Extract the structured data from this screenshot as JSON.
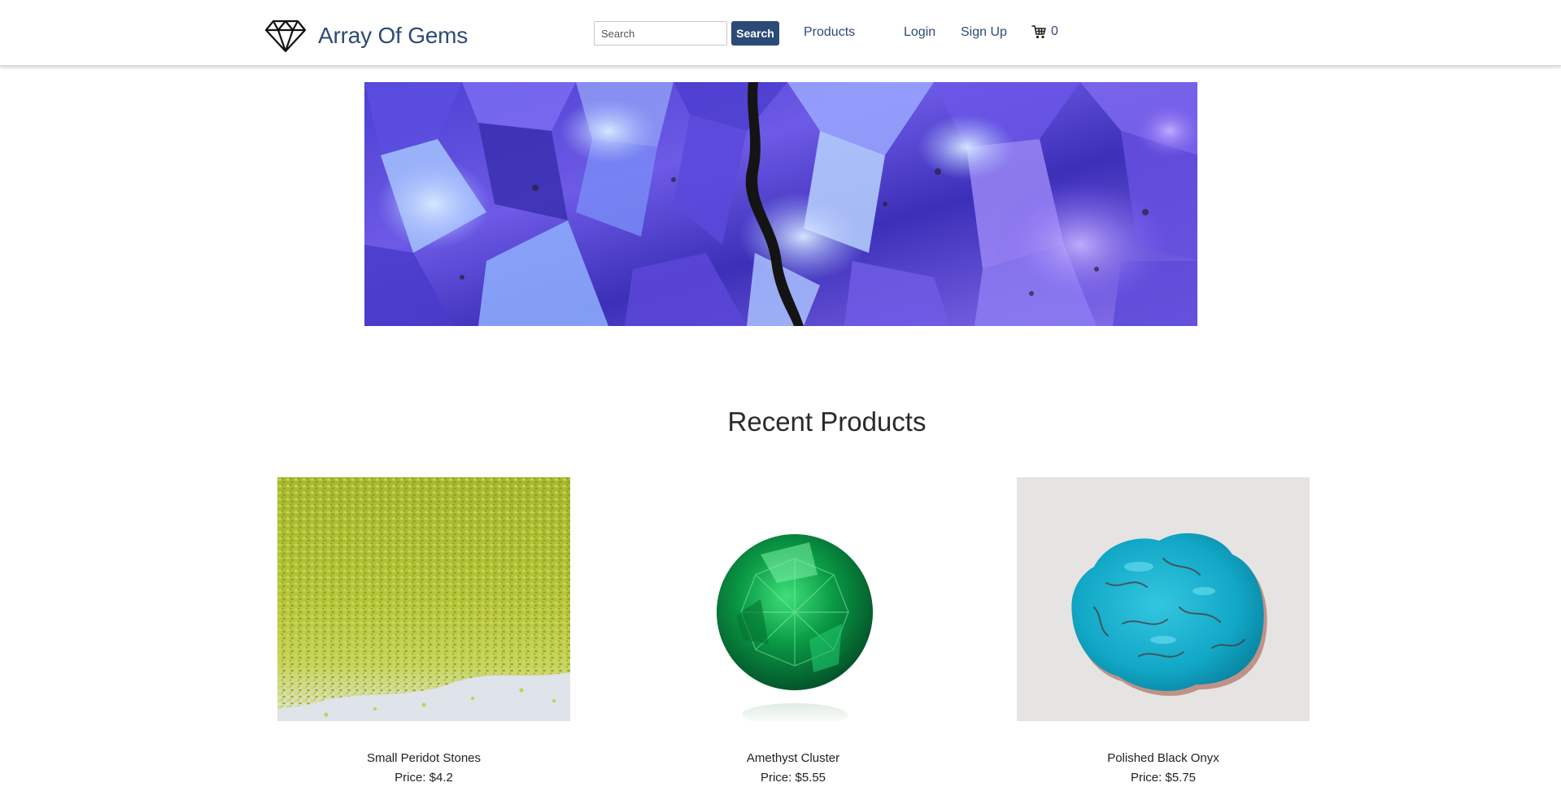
{
  "site": {
    "brand_name": "Array Of Gems",
    "brand_icon": "diamond-icon",
    "accent_color": "#2c4a78"
  },
  "navbar": {
    "search_placeholder": "Search",
    "search_value": "",
    "search_button_label": "Search",
    "products_label": "Products",
    "login_label": "Login",
    "signup_label": "Sign Up",
    "cart_icon": "shopping-cart-icon",
    "cart_count": "0"
  },
  "banner": {
    "image": "purple-crystal-cluster-banner"
  },
  "recent_products": {
    "title": "Recent Products",
    "items": [
      {
        "name": "Small Peridot Stones",
        "price": "Price: $4.2",
        "image": "green-peridot-gravel-photo"
      },
      {
        "name": "Amethyst Cluster",
        "price": "Price: $5.55",
        "image": "round-green-gem-photo"
      },
      {
        "name": "Polished Black Onyx",
        "price": "Price: $5.75",
        "image": "turquoise-stone-photo"
      }
    ]
  }
}
